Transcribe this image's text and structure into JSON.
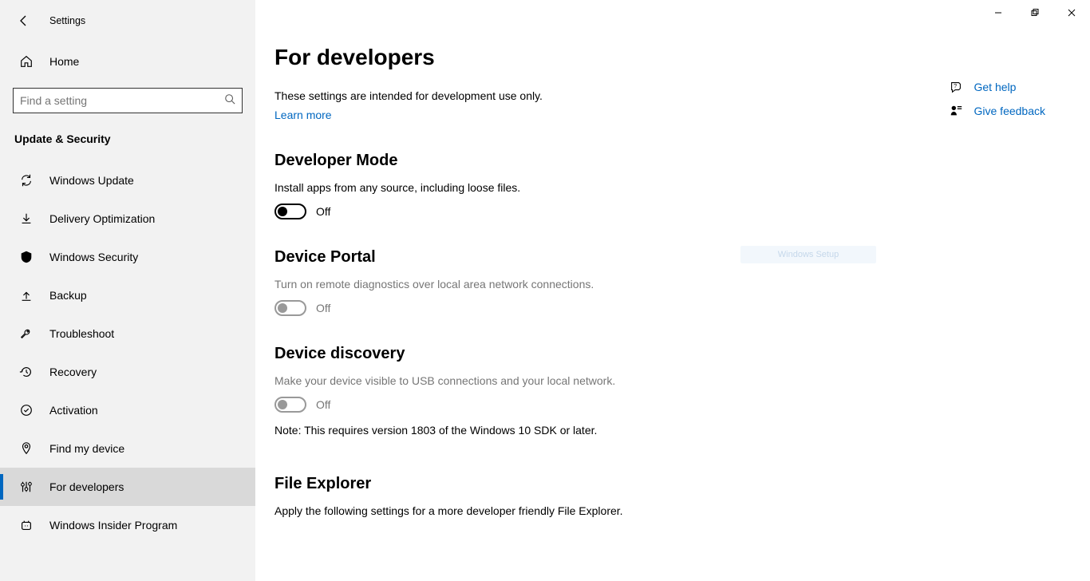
{
  "app": {
    "title": "Settings"
  },
  "sidebar": {
    "home_label": "Home",
    "search_placeholder": "Find a setting",
    "category": "Update & Security",
    "items": [
      {
        "label": "Windows Update"
      },
      {
        "label": "Delivery Optimization"
      },
      {
        "label": "Windows Security"
      },
      {
        "label": "Backup"
      },
      {
        "label": "Troubleshoot"
      },
      {
        "label": "Recovery"
      },
      {
        "label": "Activation"
      },
      {
        "label": "Find my device"
      },
      {
        "label": "For developers"
      },
      {
        "label": "Windows Insider Program"
      }
    ]
  },
  "page": {
    "title": "For developers",
    "intro": "These settings are intended for development use only.",
    "learn_more": "Learn more",
    "sections": {
      "dev_mode": {
        "heading": "Developer Mode",
        "desc": "Install apps from any source, including loose files.",
        "state": "Off"
      },
      "device_portal": {
        "heading": "Device Portal",
        "desc": "Turn on remote diagnostics over local area network connections.",
        "state": "Off"
      },
      "device_discovery": {
        "heading": "Device discovery",
        "desc": "Make your device visible to USB connections and your local network.",
        "state": "Off",
        "note": "Note: This requires version 1803 of the Windows 10 SDK or later."
      },
      "file_explorer": {
        "heading": "File Explorer",
        "desc": "Apply the following settings for a more developer friendly File Explorer."
      }
    }
  },
  "rail": {
    "help": "Get help",
    "feedback": "Give feedback"
  },
  "ghost_text": "Windows Setup"
}
